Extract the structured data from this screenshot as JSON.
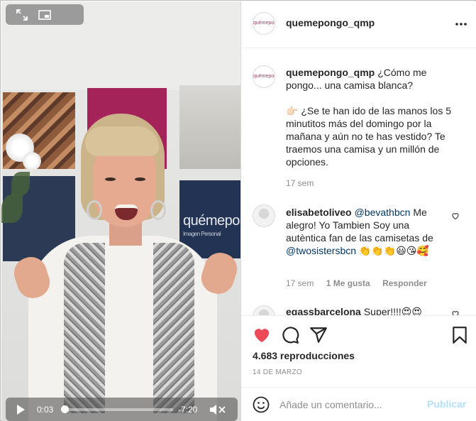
{
  "video": {
    "current_time": "0:03",
    "remaining_time": "-7:20",
    "progress": 0.007,
    "background_logo": "quémepon",
    "background_logo_sub": "Imagen Personal"
  },
  "post": {
    "username": "quemepongo_qmp",
    "avatar_text": "quémepongo",
    "caption_line1": "¿Cómo me pongo... una camisa blanca?",
    "caption_line2": "👉🏻 ¿Se te han ido de las manos los 5 minutitos más del domingo por la mañana y aún no te has vestido? Te traemos una camisa y un millón de opciones.",
    "caption_age": "17 sem"
  },
  "comments": [
    {
      "username": "elisabetoliveo",
      "mention1": "@bevathbcn",
      "text1": "Me alegro! Yo Tambien Soy una autèntica fan de las camisetas de",
      "mention2": "@twosistersbcn",
      "text2": "👏👏👏😃😘🥰",
      "age": "17 sem",
      "likes": "1 Me gusta",
      "reply": "Responder"
    },
    {
      "username": "egassbarcelona",
      "text": "Super!!!!😍😍"
    }
  ],
  "footer": {
    "views": "4.683 reproducciones",
    "date": "14 DE MARZO",
    "comment_placeholder": "Añade un comentario...",
    "post_label": "Publicar"
  },
  "icons": {
    "like": "heart-icon",
    "comment": "comment-icon",
    "share": "share-icon",
    "save": "bookmark-icon",
    "more": "more-icon",
    "expand": "expand-icon",
    "pip": "picture-in-picture-icon",
    "play": "play-icon",
    "mute": "mute-icon",
    "emoji": "emoji-icon"
  },
  "colors": {
    "like_red": "#ed4956",
    "link_blue": "#00376b",
    "post_disabled": "#b2dffc",
    "muted_gray": "#8e8e8e"
  }
}
